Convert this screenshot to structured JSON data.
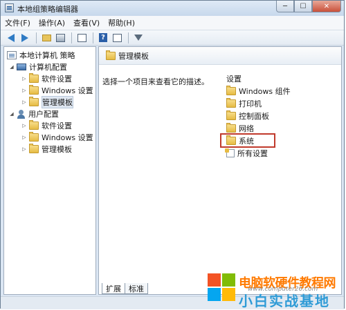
{
  "window": {
    "title": "本地组策略编辑器",
    "controls": {
      "minimize": "─",
      "maximize": "☐",
      "close": "✕"
    }
  },
  "menu": [
    "文件(F)",
    "操作(A)",
    "查看(V)",
    "帮助(H)"
  ],
  "toolbar": {
    "icons": [
      "back-arrow-icon",
      "forward-arrow-icon",
      "up-folder-icon",
      "show-hide-tree-icon",
      "export-list-icon",
      "help-icon",
      "properties-icon",
      "filter-icon"
    ],
    "help_glyph": "?"
  },
  "tree": {
    "root": "本地计算机 策略",
    "computer_config": "计算机配置",
    "computer_children": [
      "软件设置",
      "Windows 设置",
      "管理模板"
    ],
    "user_config": "用户配置",
    "user_children": [
      "软件设置",
      "Windows 设置",
      "管理模板"
    ]
  },
  "detail": {
    "header": "管理模板",
    "description": "选择一个项目来查看它的描述。",
    "settings_header": "设置",
    "items": [
      "Windows 组件",
      "打印机",
      "控制面板",
      "网络",
      "系统",
      "所有设置"
    ],
    "highlighted": "系统"
  },
  "tabs": [
    "扩展",
    "标准"
  ],
  "watermark": {
    "line1": "电脑软硬件教程网",
    "line2": "小白实战基地",
    "url": "www.computer26.com"
  },
  "colors": {
    "highlight": "#c0392b",
    "folder": "#e6bb43",
    "accent": "#2f7bc4"
  }
}
